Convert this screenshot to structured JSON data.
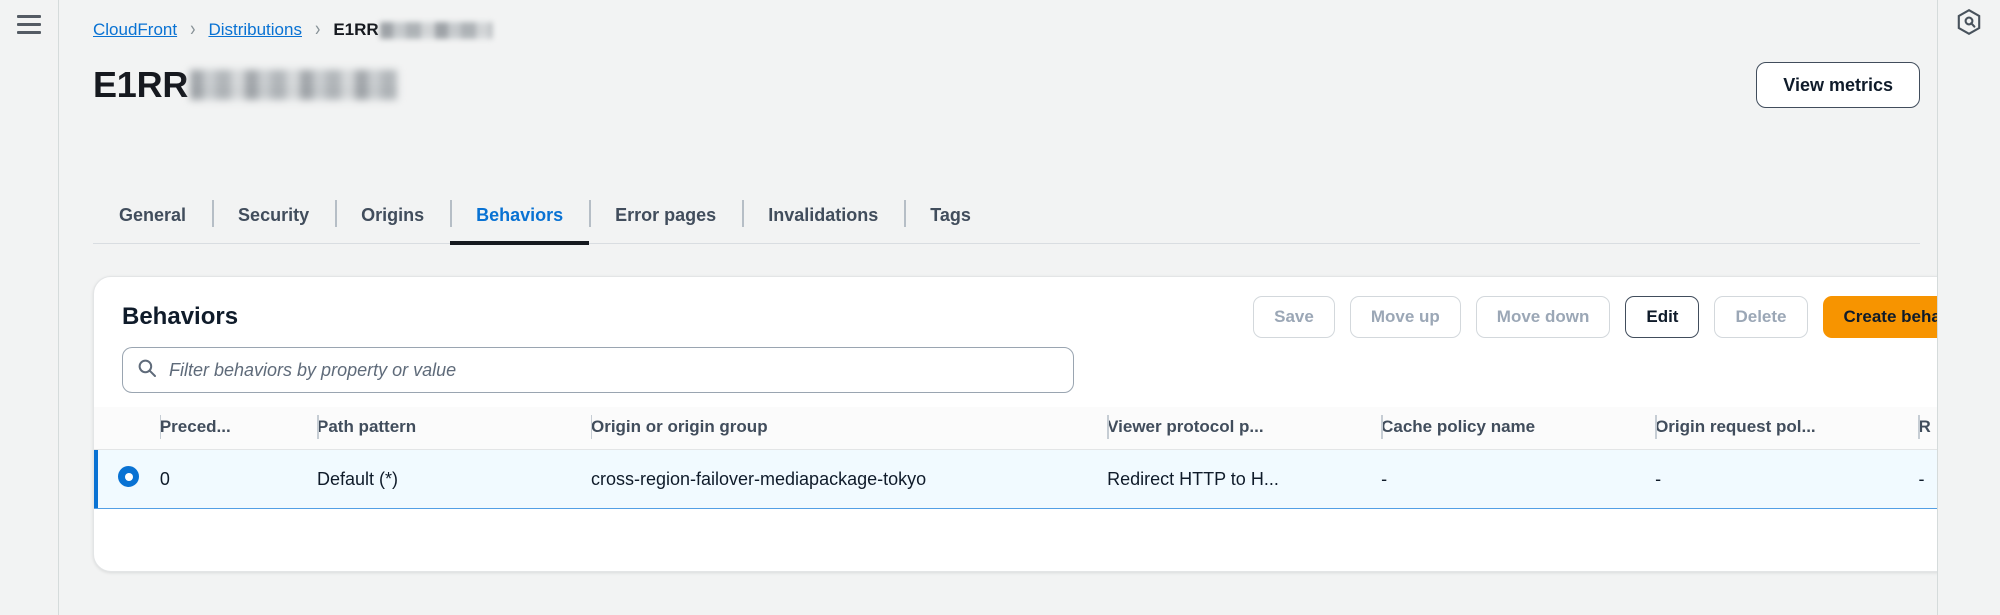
{
  "window": {
    "background": "#f2f3f3",
    "accent_color": "#0972d3",
    "primary_button_color": "#f79400"
  },
  "left_rail": {
    "menu_icon": "hamburger-menu-icon"
  },
  "right_rail": {
    "panel_icon": "amazon-q-hexagon-icon"
  },
  "breadcrumb": {
    "items": [
      {
        "label": "CloudFront",
        "link": true
      },
      {
        "label": "Distributions",
        "link": true
      }
    ],
    "separator": "›",
    "current_prefix": "E1RR",
    "current_redacted": true
  },
  "header": {
    "title_prefix": "E1RR",
    "title_redacted": true,
    "view_metrics_label": "View metrics"
  },
  "tabs": [
    {
      "label": "General",
      "active": false
    },
    {
      "label": "Security",
      "active": false
    },
    {
      "label": "Origins",
      "active": false
    },
    {
      "label": "Behaviors",
      "active": true
    },
    {
      "label": "Error pages",
      "active": false
    },
    {
      "label": "Invalidations",
      "active": false
    },
    {
      "label": "Tags",
      "active": false
    }
  ],
  "panel": {
    "title": "Behaviors",
    "actions": [
      {
        "label": "Save",
        "disabled": true,
        "variant": "normal"
      },
      {
        "label": "Move up",
        "disabled": true,
        "variant": "normal"
      },
      {
        "label": "Move down",
        "disabled": true,
        "variant": "normal"
      },
      {
        "label": "Edit",
        "disabled": false,
        "variant": "strong"
      },
      {
        "label": "Delete",
        "disabled": true,
        "variant": "normal"
      },
      {
        "label": "Create behavior",
        "disabled": false,
        "variant": "primary"
      }
    ],
    "filter": {
      "placeholder": "Filter behaviors by property or value",
      "value": "",
      "icon": "search-icon"
    },
    "preferences_icon": "gear-icon"
  },
  "table": {
    "columns": [
      {
        "key": "select",
        "label": ""
      },
      {
        "key": "prec",
        "label": "Preced..."
      },
      {
        "key": "path",
        "label": "Path pattern"
      },
      {
        "key": "origin",
        "label": "Origin or origin group"
      },
      {
        "key": "viewer",
        "label": "Viewer protocol p..."
      },
      {
        "key": "cache",
        "label": "Cache policy name"
      },
      {
        "key": "orp",
        "label": "Origin request pol..."
      },
      {
        "key": "resp",
        "label": "R"
      }
    ],
    "rows": [
      {
        "selected": true,
        "prec": "0",
        "path": "Default (*)",
        "origin": "cross-region-failover-mediapackage-tokyo",
        "viewer": "Redirect HTTP to H...",
        "cache": "-",
        "orp": "-",
        "resp": "-"
      }
    ]
  }
}
